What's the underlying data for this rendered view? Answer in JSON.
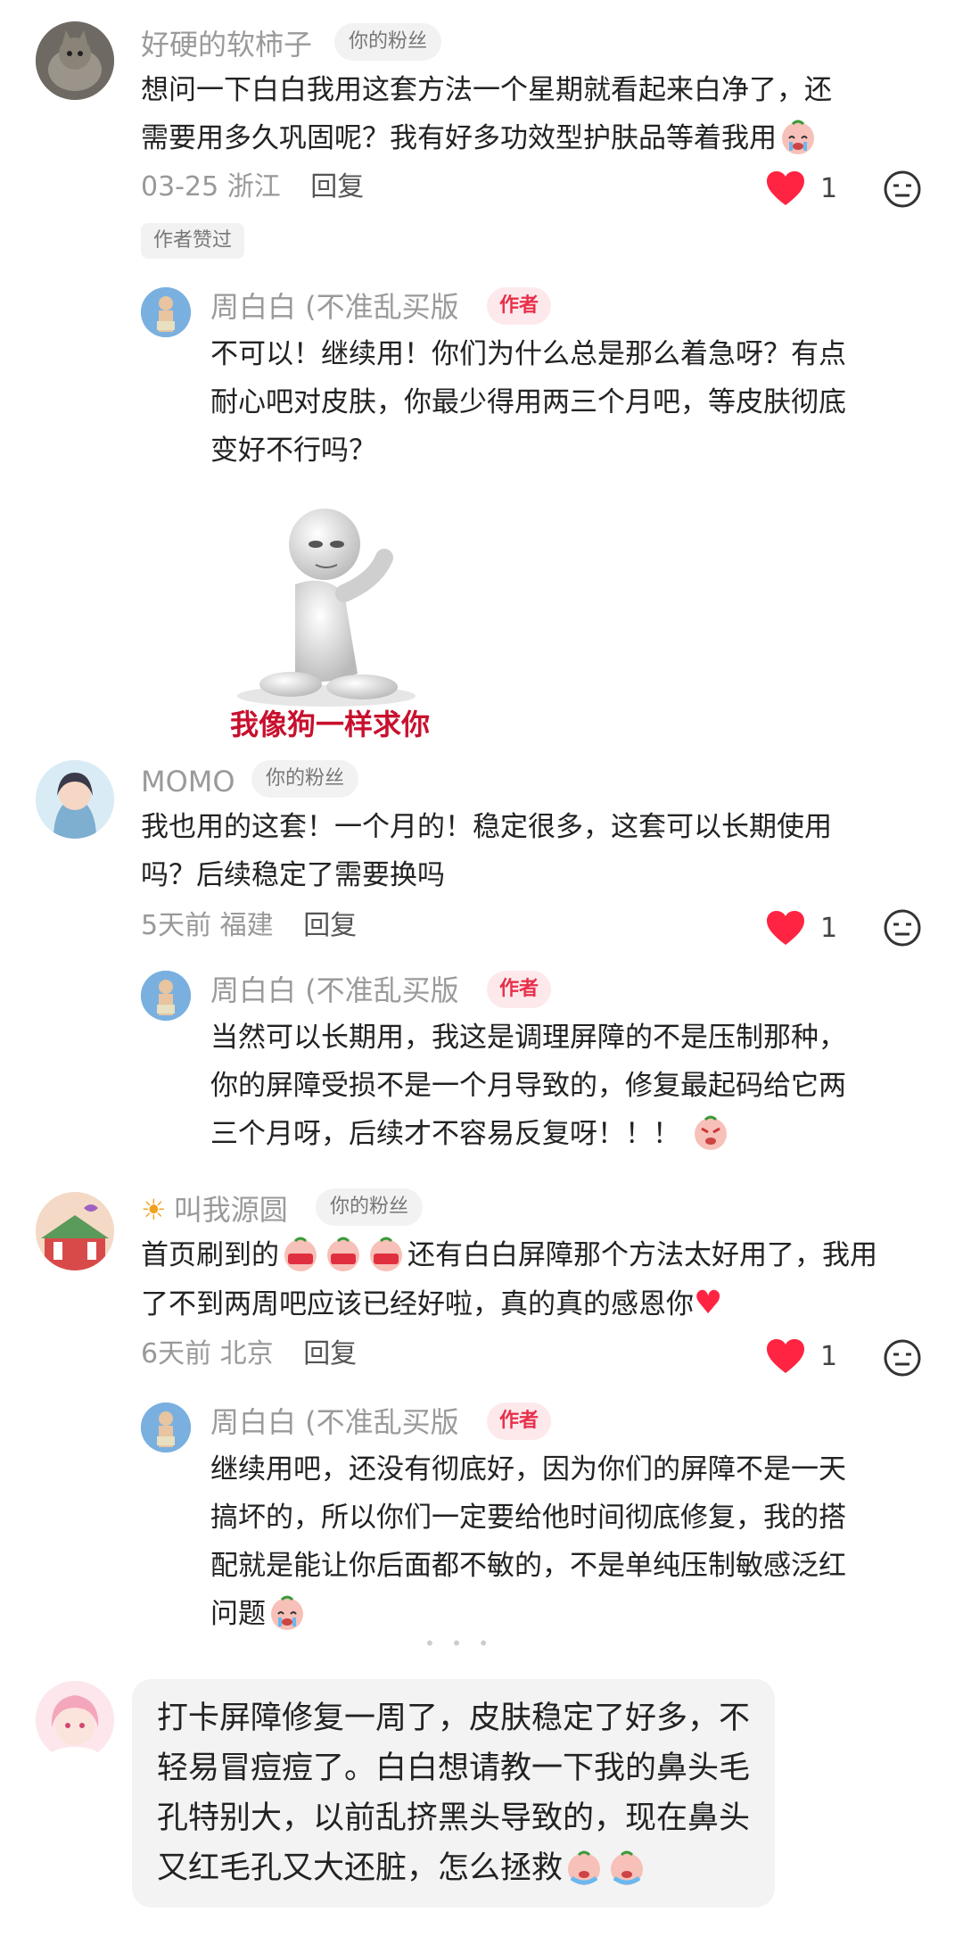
{
  "comments": [
    {
      "username": "好硬的软柿子",
      "fan_badge": "你的粉丝",
      "text_lines": [
        "想问一下白白我用这套方法一个星期就看起来白净了，还",
        "需要用多久巩固呢？我有好多功效型护肤品等着我用"
      ],
      "date": "03-25",
      "location": "浙江",
      "reply_label": "回复",
      "likes": "1",
      "author_liked": "作者赞过",
      "reply": {
        "username": "周白白 (不准乱买版",
        "author_badge": "作者",
        "text_lines": [
          "不可以！继续用！你们为什么总是那么着急呀？有点",
          "耐心吧对皮肤，你最少得用两三个月吧，等皮肤彻底",
          "变好不行吗？"
        ],
        "sticker_caption": "我像狗一样求你"
      }
    },
    {
      "username": "MOMO",
      "fan_badge": "你的粉丝",
      "text_lines": [
        "我也用的这套！一个月的！稳定很多，这套可以长期使用",
        "吗？后续稳定了需要换吗"
      ],
      "date": "5天前",
      "location": "福建",
      "reply_label": "回复",
      "likes": "1",
      "reply": {
        "username": "周白白 (不准乱买版",
        "author_badge": "作者",
        "text_lines": [
          "当然可以长期用，我这是调理屏障的不是压制那种，",
          "你的屏障受损不是一个月导致的，修复最起码给它两",
          "三个月呀，后续才不容易反复呀！！！"
        ]
      }
    },
    {
      "username": "叫我源圆",
      "fan_badge": "你的粉丝",
      "text_line1_a": "首页刷到的",
      "text_line1_b": "还有白白屏障那个方法太好用了，我用",
      "text_line2": "了不到两周吧应该已经好啦，真的真的感恩你",
      "date": "6天前",
      "location": "北京",
      "reply_label": "回复",
      "likes": "1",
      "reply": {
        "username": "周白白 (不准乱买版",
        "author_badge": "作者",
        "text_lines": [
          "继续用吧，还没有彻底好，因为你们的屏障不是一天",
          "搞坏的，所以你们一定要给他时间彻底修复，我的搭",
          "配就是能让你后面都不敏的，不是单纯压制敏感泛红",
          "问题"
        ]
      }
    }
  ],
  "draft": {
    "text_lines": [
      "打卡屏障修复一周了，皮肤稳定了好多，不",
      "轻易冒痘痘了。白白想请教一下我的鼻头毛",
      "孔特别大，以前乱挤黑头导致的，现在鼻头",
      "又红毛孔又大还脏，怎么拯救"
    ]
  },
  "colors": {
    "heart": "#ff2442",
    "author_badge_bg": "#fde9ec",
    "author_badge_text": "#e8304a"
  }
}
